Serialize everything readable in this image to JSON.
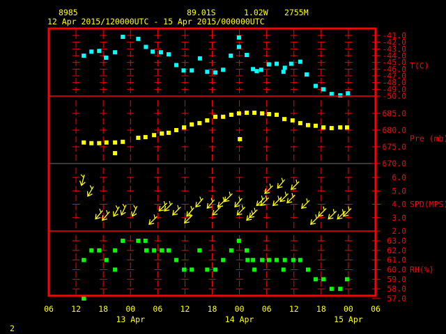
{
  "header": {
    "station_id": "8985",
    "latitude": "89.01S",
    "longitude": "1.02W",
    "elevation": "2755M",
    "time_range": "12 Apr 2015/120000UTC - 15 Apr 2015/000000UTC"
  },
  "page_number": "2",
  "colors": {
    "frame": "#ff0000",
    "temperature": "#00ffff",
    "pressure": "#ffff00",
    "wind": "#ffff00",
    "rh": "#00ff00",
    "text": "#ffff00"
  },
  "chart_data": {
    "type": "scatter",
    "title": "8985 89.01S 1.02W 2755M",
    "xaxis": {
      "unit": "hours since 12 Apr 2015 06UTC",
      "range": [
        0,
        72
      ],
      "tick_labels": [
        "06",
        "12",
        "18",
        "00",
        "06",
        "12",
        "18",
        "00",
        "06",
        "12",
        "18",
        "00",
        "06"
      ],
      "day_labels": [
        {
          "label": "13 Apr",
          "hour": 18
        },
        {
          "label": "14 Apr",
          "hour": 42
        },
        {
          "label": "15 Apr",
          "hour": 66
        }
      ]
    },
    "panels": [
      {
        "name": "T(C)",
        "type": "scatter",
        "ylim": [
          -50,
          -41
        ],
        "tick_labels": [
          "-41.0",
          "-42.0",
          "-43.0",
          "-44.0",
          "-45.0",
          "-46.0",
          "-47.0",
          "-48.0",
          "-49.0",
          "-50.0"
        ],
        "points": [
          [
            7.7,
            -44.0
          ],
          [
            9.4,
            -43.4
          ],
          [
            11.1,
            -43.3
          ],
          [
            12.6,
            -44.3
          ],
          [
            14.6,
            -43.5
          ],
          [
            16.3,
            -41.2
          ],
          [
            19.7,
            -41.5
          ],
          [
            21.4,
            -42.7
          ],
          [
            22.9,
            -43.4
          ],
          [
            24.7,
            -43.5
          ],
          [
            26.4,
            -43.8
          ],
          [
            28.1,
            -45.4
          ],
          [
            29.7,
            -46.2
          ],
          [
            31.5,
            -46.2
          ],
          [
            33.3,
            -44.4
          ],
          [
            34.9,
            -46.4
          ],
          [
            36.7,
            -46.5
          ],
          [
            38.4,
            -46.1
          ],
          [
            40.1,
            -44.0
          ],
          [
            41.9,
            -41.3
          ],
          [
            41.9,
            -42.7
          ],
          [
            43.6,
            -43.9
          ],
          [
            45.0,
            -46.0
          ],
          [
            45.8,
            -46.3
          ],
          [
            46.8,
            -46.1
          ],
          [
            48.5,
            -45.3
          ],
          [
            50.2,
            -45.2
          ],
          [
            51.7,
            -46.4
          ],
          [
            52.0,
            -45.8
          ],
          [
            53.4,
            -45.2
          ],
          [
            55.4,
            -44.9
          ],
          [
            56.8,
            -46.8
          ],
          [
            58.8,
            -48.5
          ],
          [
            60.5,
            -49.0
          ],
          [
            62.3,
            -49.7
          ],
          [
            64.2,
            -49.9
          ],
          [
            65.9,
            -49.6
          ]
        ]
      },
      {
        "name": "Pre (mb)",
        "type": "scatter",
        "ylim": [
          670,
          685
        ],
        "tick_labels": [
          "685.0",
          "680.0",
          "675.0",
          "670.0"
        ],
        "points": [
          [
            7.7,
            676.3
          ],
          [
            9.4,
            676.1
          ],
          [
            11.1,
            676.1
          ],
          [
            12.7,
            676.3
          ],
          [
            14.6,
            676.3
          ],
          [
            16.3,
            676.5
          ],
          [
            14.6,
            673.1
          ],
          [
            19.7,
            677.7
          ],
          [
            21.3,
            677.9
          ],
          [
            23.2,
            678.5
          ],
          [
            24.9,
            679.0
          ],
          [
            26.4,
            679.2
          ],
          [
            28.1,
            680.0
          ],
          [
            29.8,
            680.8
          ],
          [
            31.5,
            681.7
          ],
          [
            33.2,
            682.1
          ],
          [
            34.9,
            682.9
          ],
          [
            36.7,
            684.0
          ],
          [
            38.4,
            684.0
          ],
          [
            40.2,
            684.6
          ],
          [
            41.9,
            685.0
          ],
          [
            43.6,
            685.2
          ],
          [
            45.3,
            685.2
          ],
          [
            47.0,
            685.0
          ],
          [
            48.5,
            684.8
          ],
          [
            50.2,
            684.6
          ],
          [
            51.9,
            683.3
          ],
          [
            53.7,
            682.9
          ],
          [
            55.4,
            682.1
          ],
          [
            57.1,
            681.5
          ],
          [
            58.8,
            681.3
          ],
          [
            60.5,
            680.8
          ],
          [
            62.3,
            680.6
          ],
          [
            64.2,
            680.8
          ],
          [
            65.7,
            680.8
          ],
          [
            42.1,
            677.3
          ]
        ]
      },
      {
        "name": "SPD(MPS)",
        "type": "wind-arrows",
        "ylim": [
          2,
          6
        ],
        "tick_labels": [
          "6.0",
          "5.0",
          "4.0",
          "3.0",
          "2.0"
        ],
        "points": [
          [
            7.2,
            5.4,
            15
          ],
          [
            8.6,
            4.6,
            30
          ],
          [
            10.3,
            2.9,
            40
          ],
          [
            11.8,
            2.8,
            40
          ],
          [
            14.3,
            3.1,
            30
          ],
          [
            16.0,
            3.2,
            25
          ],
          [
            18.4,
            3.1,
            25
          ],
          [
            22.1,
            2.5,
            45
          ],
          [
            24.3,
            3.5,
            45
          ],
          [
            25.5,
            3.5,
            45
          ],
          [
            27.3,
            3.2,
            45
          ],
          [
            29.9,
            2.6,
            45
          ],
          [
            30.4,
            3.1,
            40
          ],
          [
            32.4,
            3.8,
            40
          ],
          [
            34.9,
            3.7,
            40
          ],
          [
            36.1,
            3.2,
            45
          ],
          [
            37.3,
            3.8,
            45
          ],
          [
            38.7,
            4.2,
            45
          ],
          [
            41.0,
            3.8,
            40
          ],
          [
            41.5,
            3.2,
            45
          ],
          [
            43.6,
            2.8,
            45
          ],
          [
            44.2,
            3.0,
            45
          ],
          [
            45.8,
            3.9,
            45
          ],
          [
            46.7,
            3.9,
            45
          ],
          [
            47.6,
            4.8,
            45
          ],
          [
            49.4,
            3.9,
            45
          ],
          [
            50.4,
            5.2,
            40
          ],
          [
            51.0,
            4.2,
            45
          ],
          [
            52.5,
            4.1,
            45
          ],
          [
            53.4,
            5.1,
            45
          ],
          [
            55.7,
            3.7,
            45
          ],
          [
            57.7,
            2.5,
            45
          ],
          [
            59.4,
            3.1,
            45
          ],
          [
            61.6,
            2.9,
            45
          ],
          [
            63.6,
            2.9,
            45
          ],
          [
            64.9,
            3.1,
            45
          ]
        ]
      },
      {
        "name": "RH(%)",
        "type": "scatter",
        "ylim": [
          57,
          63
        ],
        "tick_labels": [
          "63.0",
          "62.0",
          "61.0",
          "60.0",
          "59.0",
          "58.0",
          "57.0"
        ],
        "points": [
          [
            16.3,
            63
          ],
          [
            19.7,
            63
          ],
          [
            21.3,
            63
          ],
          [
            41.9,
            63
          ],
          [
            9.4,
            62
          ],
          [
            11.1,
            62
          ],
          [
            14.6,
            62
          ],
          [
            21.5,
            62
          ],
          [
            23.2,
            62
          ],
          [
            24.9,
            62
          ],
          [
            26.4,
            62
          ],
          [
            33.2,
            62
          ],
          [
            40.2,
            62
          ],
          [
            43.6,
            62
          ],
          [
            7.7,
            61
          ],
          [
            12.7,
            61
          ],
          [
            28.1,
            61
          ],
          [
            38.4,
            61
          ],
          [
            43.8,
            61
          ],
          [
            45.0,
            61
          ],
          [
            47.0,
            61
          ],
          [
            48.5,
            61
          ],
          [
            50.2,
            61
          ],
          [
            52.0,
            61
          ],
          [
            53.9,
            61
          ],
          [
            55.4,
            61
          ],
          [
            14.6,
            60
          ],
          [
            29.8,
            60
          ],
          [
            31.5,
            60
          ],
          [
            34.9,
            60
          ],
          [
            36.7,
            60
          ],
          [
            45.3,
            60
          ],
          [
            51.7,
            60
          ],
          [
            57.1,
            60
          ],
          [
            58.8,
            59
          ],
          [
            60.5,
            59
          ],
          [
            65.7,
            59
          ],
          [
            62.3,
            58
          ],
          [
            64.2,
            58
          ],
          [
            7.7,
            57
          ]
        ]
      }
    ]
  }
}
